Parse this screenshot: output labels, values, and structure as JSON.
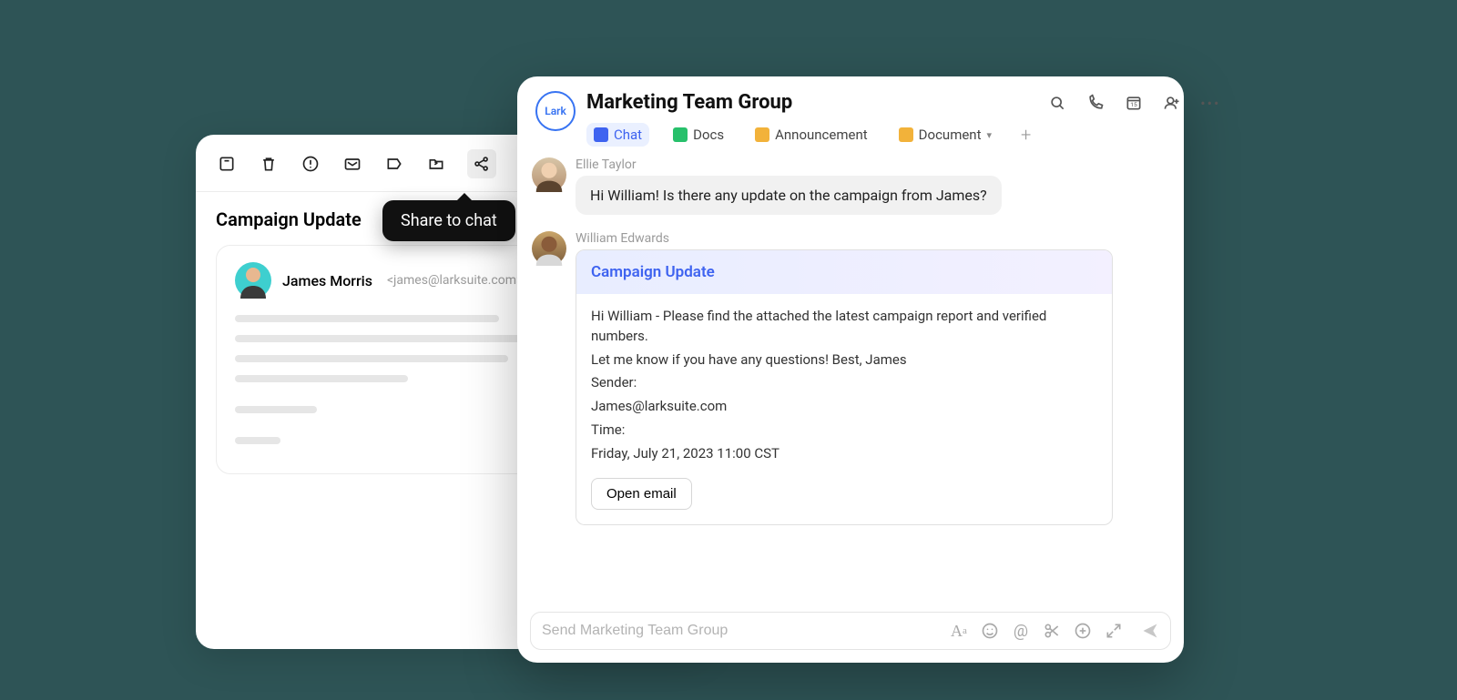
{
  "email": {
    "subject": "Campaign Update",
    "sender_name": "James Morris",
    "sender_addr": "<james@larksuite.com>"
  },
  "tooltip": "Share to chat",
  "chat": {
    "brand": "Lark",
    "title": "Marketing Team Group",
    "tabs": {
      "chat": "Chat",
      "docs": "Docs",
      "announcement": "Announcement",
      "document": "Document"
    },
    "composer_placeholder": "Send Marketing Team Group"
  },
  "messages": {
    "ellie": {
      "name": "Ellie Taylor",
      "text": "Hi William! Is there any update on the campaign from James?"
    },
    "william": {
      "name": "William Edwards",
      "card": {
        "title": "Campaign Update",
        "line1": "Hi William - Please find the attached the latest campaign report and verified numbers.",
        "line2": "Let me know if you have any questions! Best, James",
        "sender_label": "Sender:",
        "sender_value": "James@larksuite.com",
        "time_label": "Time:",
        "time_value": "Friday, July 21, 2023 11:00 CST",
        "open_btn": "Open email"
      }
    }
  }
}
